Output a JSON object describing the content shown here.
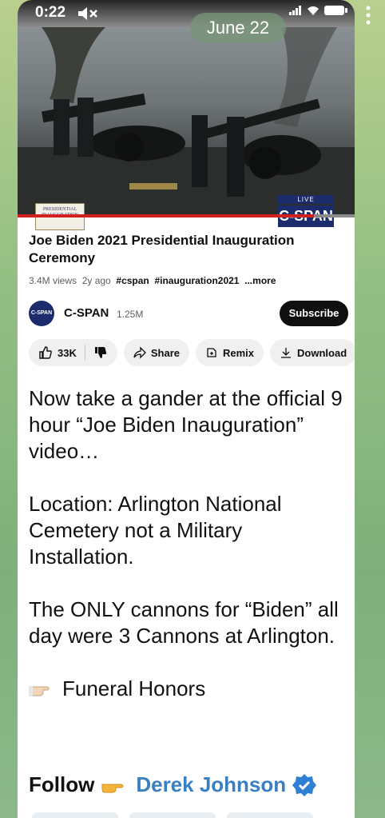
{
  "status_bar": {
    "time": "0:22",
    "date": "June 22"
  },
  "video": {
    "overlay_left": "PRESIDENTIAL INAUGURATION",
    "live": "LIVE",
    "network": "C-SPAN",
    "progress": 0.88
  },
  "youtube": {
    "title": "Joe Biden 2021 Presidential Inauguration Ceremony",
    "views": "3.4M views",
    "age": "2y ago",
    "tags": [
      "#cspan",
      "#inauguration2021"
    ],
    "more": "...more",
    "channel": {
      "logo_text": "C-SPAN",
      "name": "C-SPAN",
      "subscribers": "1.25M"
    },
    "subscribe_label": "Subscribe",
    "actions": {
      "likes": "33K",
      "share": "Share",
      "remix": "Remix",
      "download": "Download"
    }
  },
  "message": {
    "paragraph_1": "Now take a gander at the official 9 hour  “Joe Biden Inauguration” video…",
    "paragraph_2": "Location: Arlington National Cemetery not a Military Installation.",
    "paragraph_3": "The ONLY cannons for “Biden” all day were 3 Cannons at Arlington.",
    "paragraph_4": "Funeral Honors",
    "follow_label": "Follow",
    "follow_name": "Derek Johnson"
  },
  "icons": [
    "mute-icon",
    "signal-icon",
    "wifi-icon",
    "battery-icon",
    "more-vert-icon",
    "thumbs-up-icon",
    "thumbs-down-icon",
    "share-icon",
    "remix-icon",
    "download-icon",
    "pointing-hand-icon",
    "verified-badge-icon"
  ]
}
